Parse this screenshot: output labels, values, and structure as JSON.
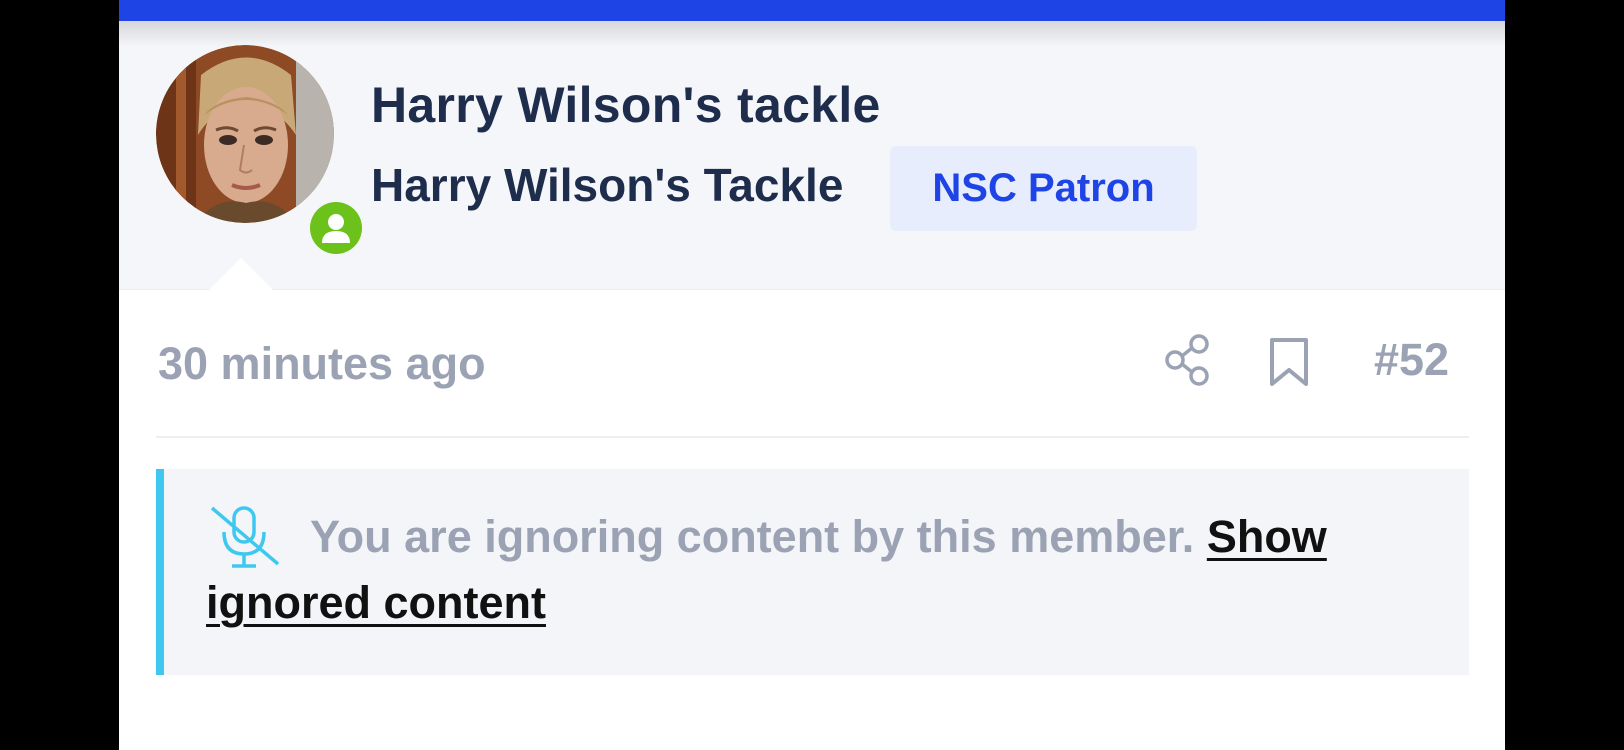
{
  "header": {
    "accent_color": "#1e44e6"
  },
  "user": {
    "name": "Harry Wilson's tackle",
    "title": "Harry Wilson's Tackle",
    "banner": "NSC Patron",
    "status": "online",
    "status_color": "#6cc21b"
  },
  "post": {
    "time": "30 minutes ago",
    "number": "#52",
    "icons": [
      "share-icon",
      "bookmark-icon"
    ]
  },
  "ignored": {
    "message": "You are ignoring content by this member.",
    "show_link": "Show ignored content",
    "accent_color": "#3ec8f0",
    "icon": "microphone-slash-icon"
  }
}
